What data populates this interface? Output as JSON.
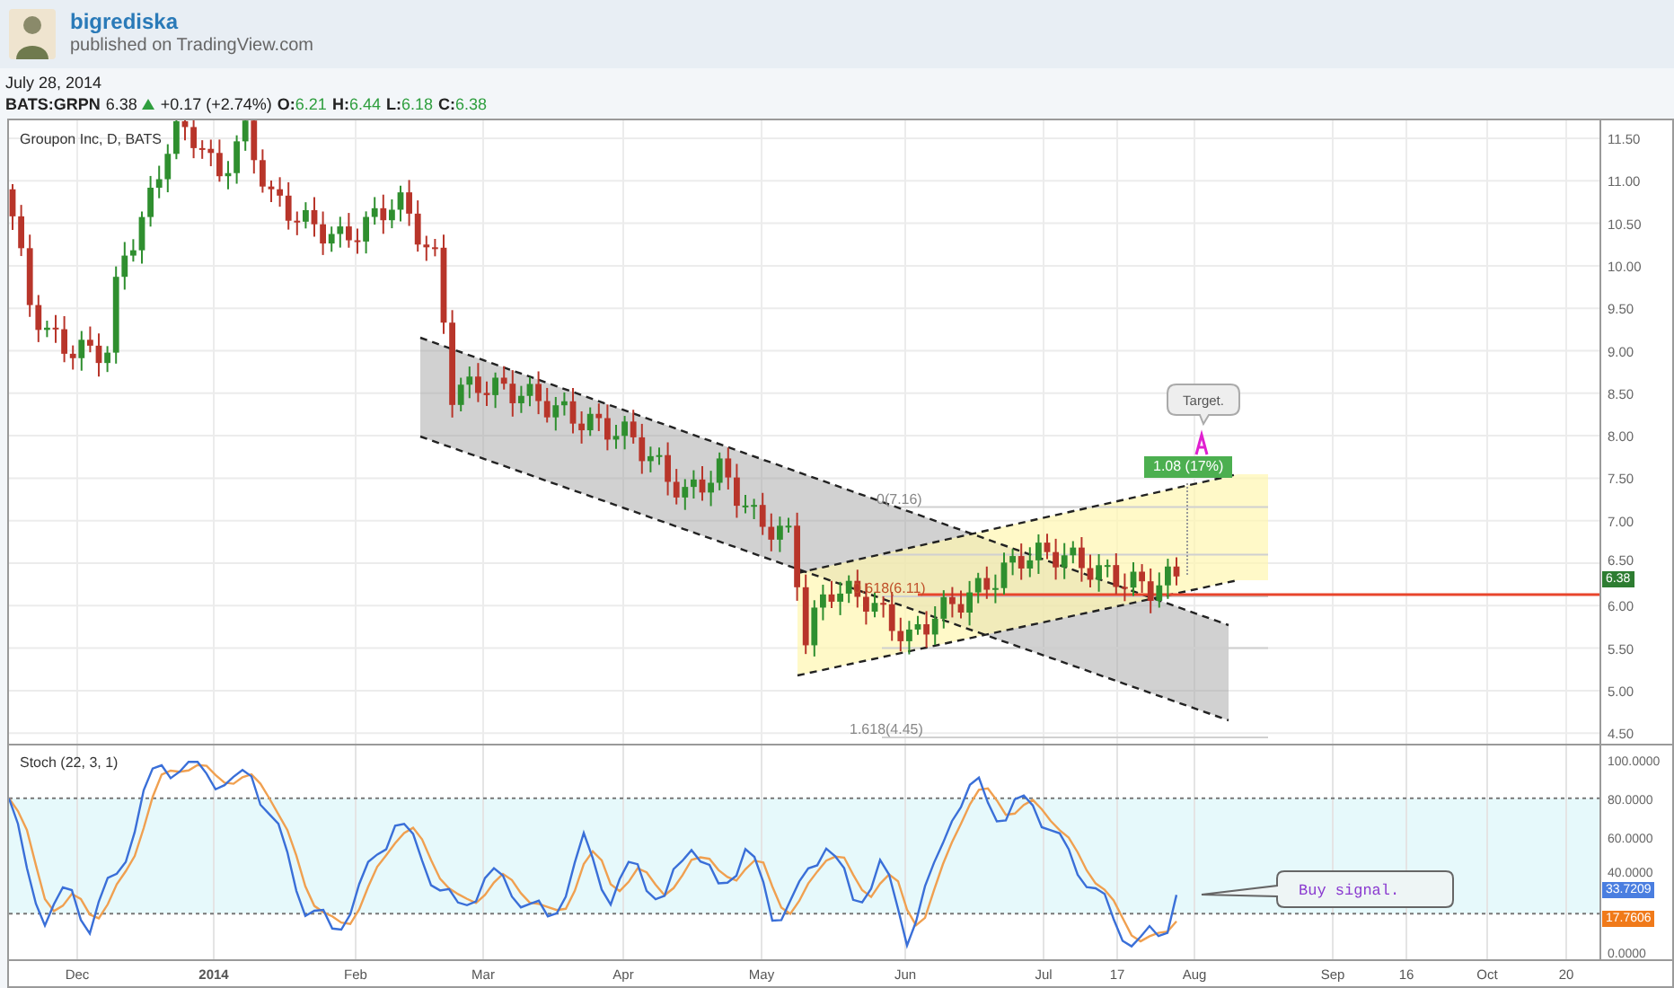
{
  "author": {
    "name": "bigrediska",
    "subtitle": "published on TradingView.com"
  },
  "date": "July 28, 2014",
  "quote": {
    "symbol": "BATS:GRPN",
    "last": "6.38",
    "change": "+0.17 (+2.74%)",
    "ohlc": [
      {
        "label": "O:",
        "value": "6.21"
      },
      {
        "label": "H:",
        "value": "6.44"
      },
      {
        "label": "L:",
        "value": "6.18"
      },
      {
        "label": "C:",
        "value": "6.38"
      }
    ]
  },
  "price_pane": {
    "legend": "Groupon Inc, D, BATS",
    "axis_labels": [
      "11.50",
      "11.00",
      "10.50",
      "10.00",
      "9.50",
      "9.00",
      "8.50",
      "8.00",
      "7.50",
      "7.00",
      "6.50",
      "6.00",
      "5.50",
      "5.00",
      "4.50"
    ],
    "last_price": "6.38",
    "fib_labels": [
      "0(7.16)",
      "0.618(6.11)",
      "1.618(4.45)"
    ],
    "target_note": "Target.",
    "measure_label": "1.08 (17%)"
  },
  "stoch_pane": {
    "legend": "Stoch (22, 3, 1)",
    "axis_labels": [
      "100.0000",
      "80.0000",
      "60.0000",
      "40.0000",
      "0.0000"
    ],
    "k_value": "33.7209",
    "d_value": "17.7606",
    "note": "Buy signal."
  },
  "time_axis": [
    {
      "label": "Dec",
      "kind": "month"
    },
    {
      "label": "2014",
      "kind": "year"
    },
    {
      "label": "Feb",
      "kind": "month"
    },
    {
      "label": "Mar",
      "kind": "month"
    },
    {
      "label": "Apr",
      "kind": "month"
    },
    {
      "label": "May",
      "kind": "month"
    },
    {
      "label": "Jun",
      "kind": "month"
    },
    {
      "label": "Jul",
      "kind": "month"
    },
    {
      "label": "17",
      "kind": "day"
    },
    {
      "label": "Aug",
      "kind": "month"
    },
    {
      "label": "Sep",
      "kind": "month"
    },
    {
      "label": "16",
      "kind": "day"
    },
    {
      "label": "Oct",
      "kind": "month"
    },
    {
      "label": "20",
      "kind": "day"
    }
  ]
}
